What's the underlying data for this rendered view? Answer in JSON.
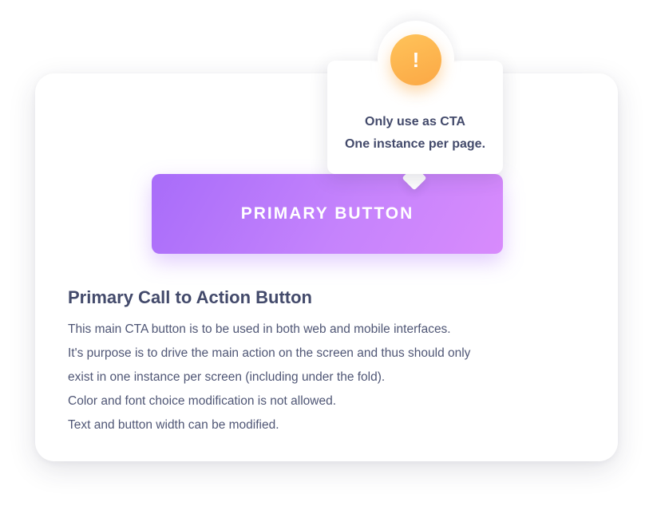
{
  "tooltip": {
    "icon": "exclamation-icon",
    "icon_glyph": "!",
    "line1": "Only use as CTA",
    "line2": "One instance per page."
  },
  "button": {
    "label": "PRIMARY BUTTON"
  },
  "section": {
    "title": "Primary Call to Action Button",
    "lines": [
      "This main CTA button is to be used in both web and mobile interfaces.",
      "It's purpose is to drive the main action on the screen and thus should only",
      "exist in one instance per screen (including under the fold).",
      "Color and font choice modification is not allowed.",
      "Text and button width can be modified."
    ]
  },
  "colors": {
    "button_gradient_start": "#a86cf9",
    "button_gradient_end": "#d88bfc",
    "badge": "#fba845",
    "text": "#434a6b"
  }
}
